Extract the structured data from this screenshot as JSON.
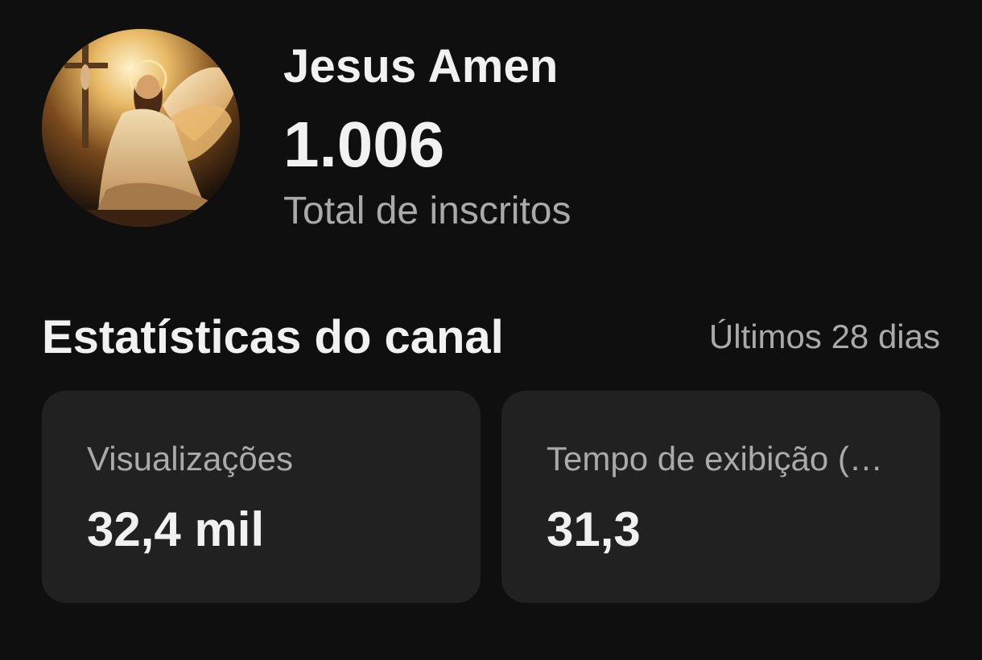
{
  "channel": {
    "name": "Jesus Amen",
    "subscriber_count": "1.006",
    "subscriber_label": "Total de inscritos"
  },
  "stats": {
    "title": "Estatísticas do canal",
    "period": "Últimos 28 dias",
    "cards": [
      {
        "label": "Visualizações",
        "value": "32,4 mil"
      },
      {
        "label": "Tempo de exibição (…",
        "value": "31,3"
      }
    ]
  },
  "colors": {
    "background": "#0f0f0f",
    "card_background": "#212121",
    "primary_text": "#f1f1f1",
    "secondary_text": "#aaaaaa"
  }
}
